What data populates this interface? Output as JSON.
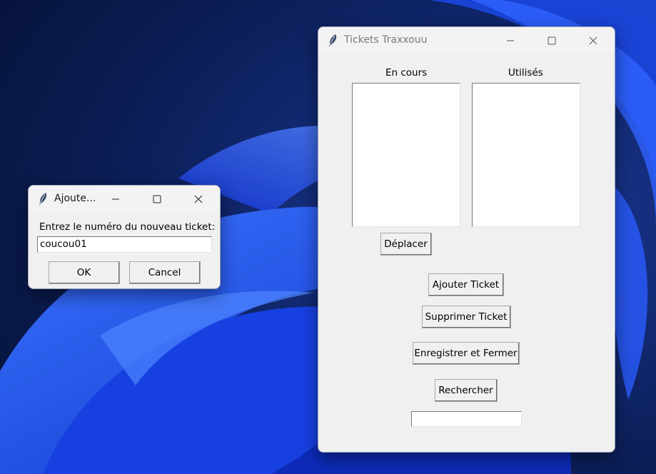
{
  "colors": {
    "desktop_dark": "#0a1a4a",
    "bloom_blue": "#1d4fe8",
    "window_bg": "#f0f0f0"
  },
  "main_window": {
    "title": "Tickets Traxxouu",
    "icon": "feather-icon",
    "label_en_cours": "En cours",
    "label_utilises": "Utilisés",
    "list_en_cours": [],
    "list_utilises": [],
    "btn_deplacer": "Déplacer",
    "btn_ajouter": "Ajouter Ticket",
    "btn_supprimer": "Supprimer Ticket",
    "btn_enregistrer": "Enregistrer et Fermer",
    "btn_rechercher": "Rechercher",
    "search_value": ""
  },
  "dialog": {
    "title": "Ajoute...",
    "icon": "feather-icon",
    "prompt": "Entrez le numéro du nouveau ticket:",
    "input_value": "coucou01",
    "ok_label": "OK",
    "cancel_label": "Cancel"
  },
  "caption_icons": {
    "minimize": "minimize-icon",
    "maximize": "maximize-icon",
    "close": "close-icon"
  }
}
